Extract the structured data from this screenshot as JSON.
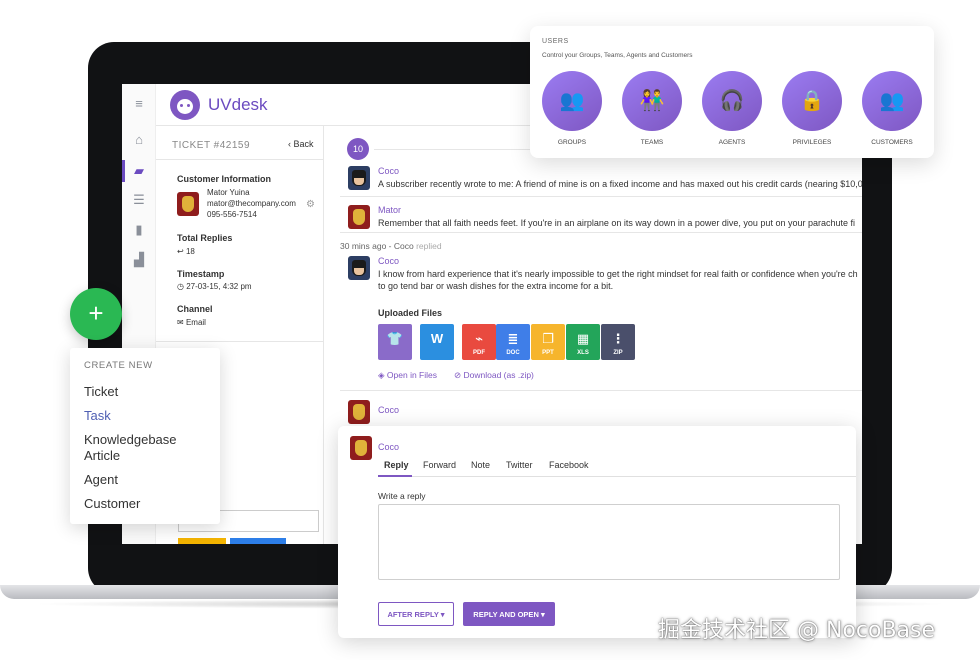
{
  "app": {
    "name": "UVdesk"
  },
  "ticket": {
    "number": "TICKET #42159",
    "back_label": "Back",
    "customer_info_label": "Customer Information",
    "customer_name": "Mator Yuina",
    "customer_email": "mator@thecompany.com",
    "customer_phone": "095-556-7514",
    "total_replies_label": "Total Replies",
    "total_replies": "18",
    "timestamp_label": "Timestamp",
    "timestamp": "27-03-15, 4:32 pm",
    "channel_label": "Channel",
    "channel": "Email"
  },
  "thread": {
    "count": "10",
    "messages": [
      {
        "author": "Coco",
        "text": "A subscriber recently wrote to me: A friend of mine is on a fixed income and has maxed out his credit cards (nearing $10,000"
      },
      {
        "author": "Mator",
        "text": "Remember that all faith needs feet. If you're in an airplane on its way down in a power dive, you put on your parachute fi"
      },
      {
        "author": "Coco",
        "text": "I know from hard experience that it's nearly impossible to get the right mindset for real faith or confidence when you're ch to go tend bar or wash dishes for the extra income for a bit."
      },
      {
        "author": "Coco",
        "text": ""
      }
    ],
    "meta_time": "30 mins ago",
    "meta_author": "Coco",
    "meta_action": "replied",
    "uploaded_files_label": "Uploaded Files",
    "files": [
      {
        "type": "",
        "color": "#8a6bc9"
      },
      {
        "type": "",
        "color": "#2b8fe0"
      },
      {
        "type": "PDF",
        "color": "#e94a3f"
      },
      {
        "type": "DOC",
        "color": "#3f7ee8"
      },
      {
        "type": "PPT",
        "color": "#f6b52c"
      },
      {
        "type": "XLS",
        "color": "#23a55a"
      },
      {
        "type": "ZIP",
        "color": "#4a4f6b"
      }
    ],
    "open_in_files": "Open in Files",
    "download_zip": "Download (as .zip)"
  },
  "users_card": {
    "title": "USERS",
    "subtitle": "Control your Groups, Teams, Agents and Customers",
    "items": [
      {
        "label": "GROUPS"
      },
      {
        "label": "TEAMS"
      },
      {
        "label": "AGENTS"
      },
      {
        "label": "PRIVILEGES"
      },
      {
        "label": "CUSTOMERS"
      }
    ]
  },
  "create_menu": {
    "title": "CREATE NEW",
    "fab_symbol": "+",
    "items": [
      "Ticket",
      "Task",
      "Knowledgebase Article",
      "Agent",
      "Customer"
    ]
  },
  "reply_panel": {
    "author": "Coco",
    "tabs": [
      "Reply",
      "Forward",
      "Note",
      "Twitter",
      "Facebook"
    ],
    "write_label": "Write a reply",
    "after_reply": "AFTER REPLY",
    "reply_and_open": "REPLY AND OPEN"
  },
  "watermark": "掘金技术社区 @ NocoBase",
  "colors": {
    "accent": "#7e57c2",
    "fab": "#2ab853"
  }
}
